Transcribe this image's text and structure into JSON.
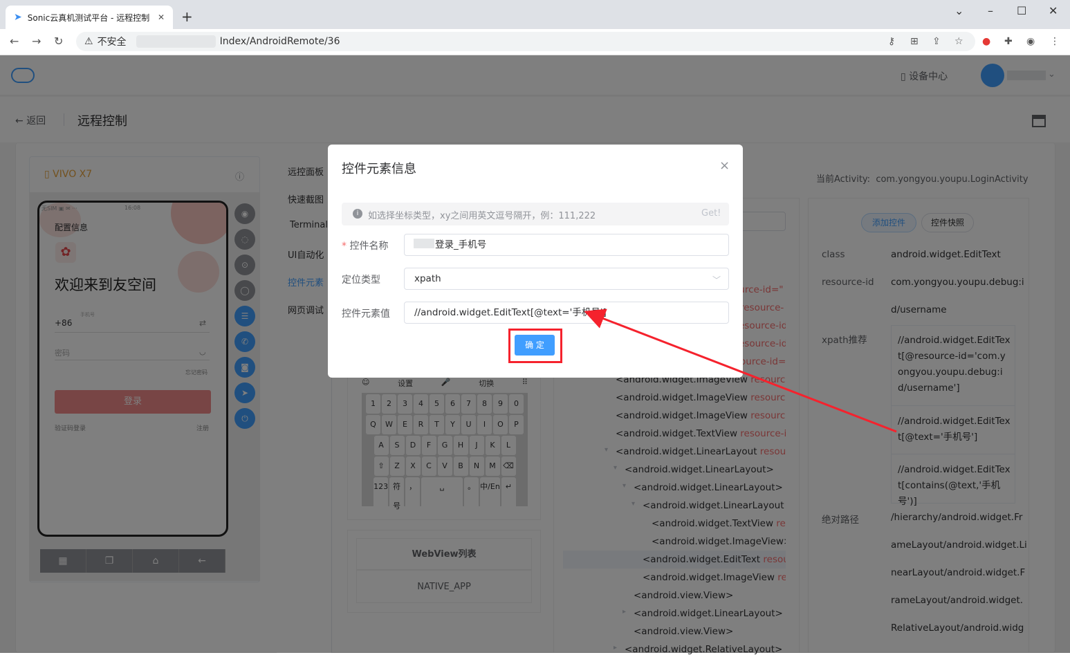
{
  "browser": {
    "tab_title": "Sonic云真机测试平台 - 远程控制",
    "tab_close": "✕",
    "new_tab": "+",
    "win_min": "⌄",
    "win_restore": "–",
    "win_max": "☐",
    "win_close": "✕",
    "insecure_label": "不安全",
    "url": "Index/AndroidRemote/36"
  },
  "topnav": {
    "device_center": "设备中心"
  },
  "header": {
    "back": "返回",
    "title": "远程控制"
  },
  "device": {
    "name": "VIVO X7",
    "status_left": "无SIM ▣ ✉ ···",
    "status_time": "16:08",
    "app": {
      "config": "配置信息",
      "welcome": "欢迎来到友空间",
      "country_code": "+86",
      "phone_hint": "手机号",
      "password": "密码",
      "forgot": "忘记密码",
      "login": "登录",
      "sms_login": "验证码登录",
      "register": "注册"
    },
    "side_buttons": [
      "◉",
      "◌",
      "⊙",
      "◯",
      "☰",
      "✆",
      "◙",
      "➤",
      "⏻"
    ],
    "navbar": [
      "▦",
      "❐",
      "⌂",
      "←"
    ]
  },
  "left_tabs": [
    "远控面板",
    "快速截图",
    "Terminal",
    "UI自动化",
    "控件元素",
    "网页调试"
  ],
  "keyboard": {
    "top": [
      "☺",
      "设置",
      "🎤",
      "切换",
      "⠿"
    ],
    "rows": [
      [
        "1",
        "2",
        "3",
        "4",
        "5",
        "6",
        "7",
        "8",
        "9",
        "0"
      ],
      [
        "Q",
        "W",
        "E",
        "R",
        "T",
        "Y",
        "U",
        "I",
        "O",
        "P"
      ],
      [
        "A",
        "S",
        "D",
        "F",
        "G",
        "H",
        "J",
        "K",
        "L"
      ],
      [
        "⇧",
        "Z",
        "X",
        "C",
        "V",
        "B",
        "N",
        "M",
        "⌫"
      ],
      [
        "123",
        "符号",
        "，",
        "␣",
        "。",
        "中/En",
        "↵"
      ]
    ]
  },
  "webview": {
    "title": "WebView列表",
    "item": "NATIVE_APP"
  },
  "tree": {
    "nodes": [
      {
        "tag": "",
        "attr": "ource-id=\""
      },
      {
        "tag": "",
        "attr": "resource-"
      },
      {
        "tag": "",
        "attr": "esource-id"
      },
      {
        "tag": "",
        "attr": "esource-id"
      },
      {
        "tag": "",
        "attr": "ource-id=\""
      },
      {
        "tag": "<android.widget.ImageView ",
        "attr": "resource-id"
      },
      {
        "tag": "<android.widget.ImageView ",
        "attr": "resource-id"
      },
      {
        "tag": "<android.widget.ImageView ",
        "attr": "resource-id"
      },
      {
        "tag": "<android.widget.TextView ",
        "attr": "resource-id=\""
      },
      {
        "tag": "<android.widget.LinearLayout ",
        "attr": "resource-"
      },
      {
        "tag": "<android.widget.LinearLayout>",
        "attr": ""
      },
      {
        "tag": "<android.widget.LinearLayout>",
        "attr": ""
      },
      {
        "tag": "<android.widget.LinearLayout ",
        "attr": "res"
      },
      {
        "tag": "<android.widget.TextView ",
        "attr": "resou"
      },
      {
        "tag": "<android.widget.ImageView>",
        "attr": ""
      },
      {
        "tag": "<android.widget.EditText ",
        "attr": "resource"
      },
      {
        "tag": "<android.widget.ImageView ",
        "attr": "resou"
      },
      {
        "tag": "<android.view.View>",
        "attr": ""
      },
      {
        "tag": "<android.widget.LinearLayout>",
        "attr": ""
      },
      {
        "tag": "<android.view.View>",
        "attr": ""
      },
      {
        "tag": "<android.widget.RelativeLayout>",
        "attr": ""
      }
    ]
  },
  "right": {
    "activity_label": "当前Activity:",
    "activity": "com.yongyou.youpu.LoginActivity",
    "add_control": "添加控件",
    "snapshot": "控件快照",
    "class_label": "class",
    "class_value": "android.widget.EditText",
    "rid_label": "resource-id",
    "rid_value_1": "com.yongyou.youpu.debug:i",
    "rid_value_2": "d/username",
    "xpath_label": "xpath推荐",
    "xpath_1": "//android.widget.EditText[@resource-id='com.yongyou.youpu.debug:id/username']",
    "xpath_2": "//android.widget.EditText[@text='手机号']",
    "xpath_3": "//android.widget.EditText[contains(@text,'手机号')]",
    "abs_label": "绝对路径",
    "abs_lines": [
      "/hierarchy/android.widget.Fr",
      "ameLayout/android.widget.Li",
      "nearLayout/android.widget.F",
      "rameLayout/android.widget.",
      "RelativeLayout/android.widg"
    ]
  },
  "dialog": {
    "title": "控件元素信息",
    "close": "×",
    "alert": "如选择坐标类型，xy之间用英文逗号隔开，例：111,222",
    "alert_get": "Get!",
    "name_label": "控件名称",
    "name_value": "登录_手机号",
    "type_label": "定位类型",
    "type_value": "xpath",
    "value_label": "控件元素值",
    "value_value": "//android.widget.EditText[@text='手机号']",
    "ok": "确 定"
  },
  "colors": {
    "accent": "#409eff",
    "danger": "#f56c6c",
    "annotation": "#f5222d"
  }
}
